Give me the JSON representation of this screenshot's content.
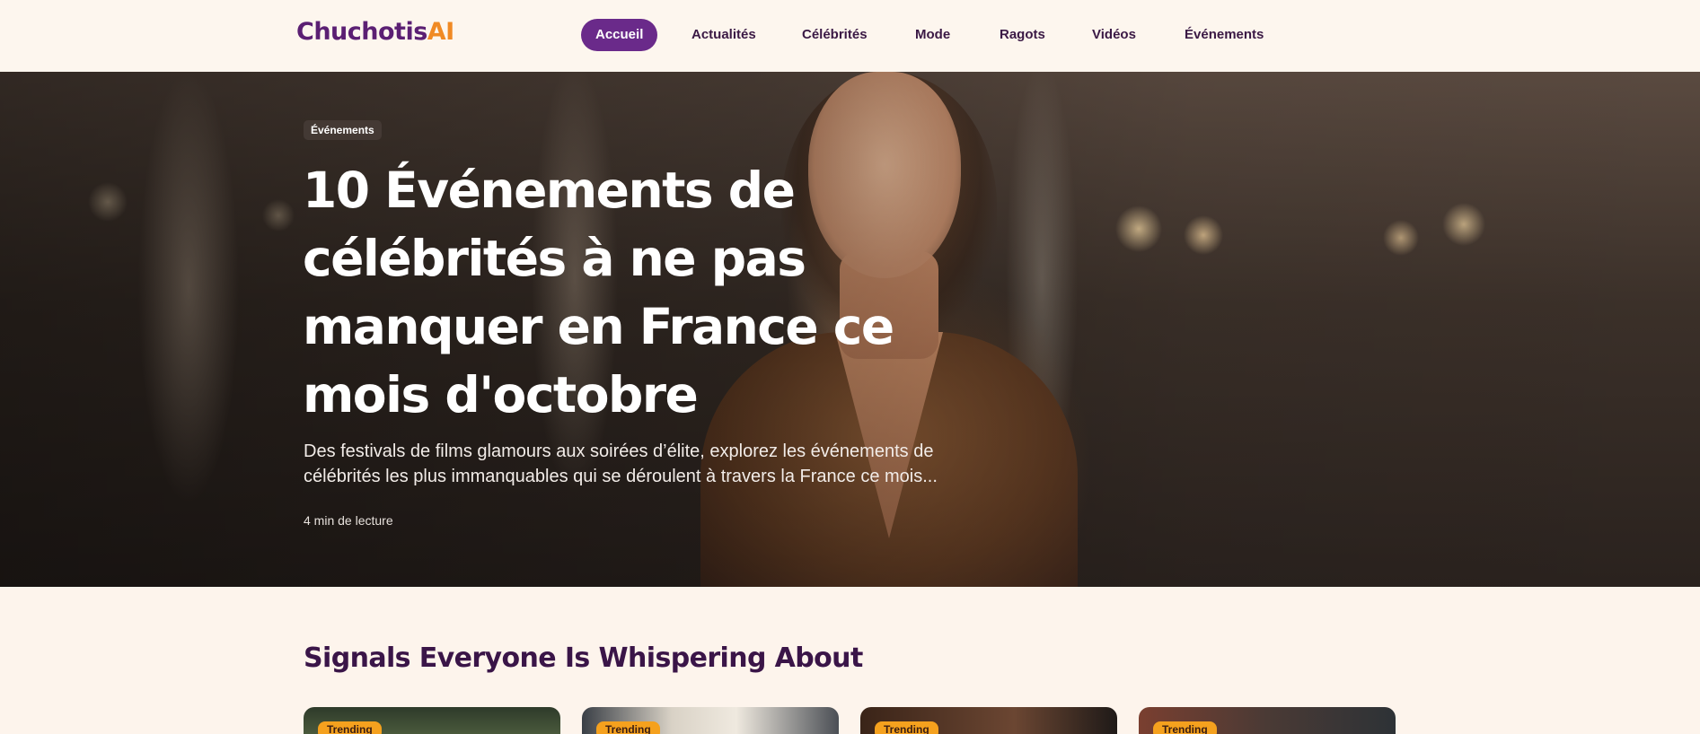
{
  "header": {
    "logo_main": "Chuchotis",
    "logo_accent": "AI",
    "nav": [
      {
        "label": "Accueil",
        "active": true
      },
      {
        "label": "Actualités",
        "active": false
      },
      {
        "label": "Célébrités",
        "active": false
      },
      {
        "label": "Mode",
        "active": false
      },
      {
        "label": "Ragots",
        "active": false
      },
      {
        "label": "Vidéos",
        "active": false
      },
      {
        "label": "Événements",
        "active": false
      }
    ]
  },
  "hero": {
    "category": "Événements",
    "title": "10 Événements de célébrités à ne pas manquer en France ce mois d'octobre",
    "excerpt": "Des festivals de films glamours aux soirées d’élite, explorez les événements de célébrités les plus immanquables qui se déroulent à travers la France ce mois...",
    "read_time": "4 min de lecture"
  },
  "section": {
    "title": "Signals Everyone Is Whispering About",
    "cards": [
      {
        "tag": "Trending"
      },
      {
        "tag": "Trending"
      },
      {
        "tag": "Trending"
      },
      {
        "tag": "Trending"
      }
    ]
  },
  "colors": {
    "brand_purple": "#5b1f73",
    "brand_orange": "#f08a24",
    "nav_active_bg": "#6a2a8a",
    "page_bg": "#fdf4ec",
    "tag_bg": "#f5a11e"
  }
}
